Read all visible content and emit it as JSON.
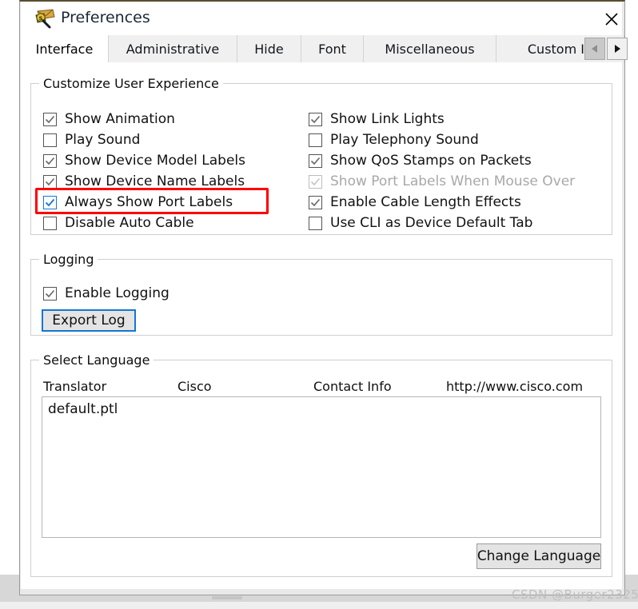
{
  "window": {
    "title": "Preferences",
    "icon": "packet-tracer-envelope-magnifier-icon",
    "close_label": "✕"
  },
  "tabs": {
    "items": [
      {
        "label": "Interface",
        "active": true
      },
      {
        "label": "Administrative",
        "active": false
      },
      {
        "label": "Hide",
        "active": false
      },
      {
        "label": "Font",
        "active": false
      },
      {
        "label": "Miscellaneous",
        "active": false
      },
      {
        "label": "Custom In",
        "active": false
      }
    ],
    "scroll_left": "◀",
    "scroll_right": "▶"
  },
  "customize": {
    "title": "Customize User Experience",
    "left_column": [
      {
        "label": "Show Animation",
        "checked": true,
        "enabled": true,
        "highlighted": false
      },
      {
        "label": "Play Sound",
        "checked": false,
        "enabled": true,
        "highlighted": false
      },
      {
        "label": "Show Device Model Labels",
        "checked": true,
        "enabled": true,
        "highlighted": false
      },
      {
        "label": "Show Device Name Labels",
        "checked": true,
        "enabled": true,
        "highlighted": false
      },
      {
        "label": "Always Show Port Labels",
        "checked": true,
        "enabled": true,
        "highlighted": true
      },
      {
        "label": "Disable Auto Cable",
        "checked": false,
        "enabled": true,
        "highlighted": false
      }
    ],
    "right_column": [
      {
        "label": "Show Link Lights",
        "checked": true,
        "enabled": true,
        "highlighted": false
      },
      {
        "label": "Play Telephony Sound",
        "checked": false,
        "enabled": true,
        "highlighted": false
      },
      {
        "label": "Show QoS Stamps on Packets",
        "checked": true,
        "enabled": true,
        "highlighted": false
      },
      {
        "label": "Show Port Labels When Mouse Over",
        "checked": true,
        "enabled": false,
        "highlighted": false
      },
      {
        "label": "Enable Cable Length Effects",
        "checked": true,
        "enabled": true,
        "highlighted": false
      },
      {
        "label": "Use CLI as Device Default Tab",
        "checked": false,
        "enabled": true,
        "highlighted": false
      }
    ],
    "highlight_color": "#ff0000"
  },
  "logging": {
    "title": "Logging",
    "enable_logging": {
      "label": "Enable Logging",
      "checked": true
    },
    "export_button": "Export Log",
    "export_button_focus_color": "#1676d2"
  },
  "language": {
    "title": "Select Language",
    "headers": [
      "Translator",
      "Cisco",
      "Contact Info",
      "http://www.cisco.com"
    ],
    "list_items": [
      "default.ptl"
    ],
    "change_button": "Change Language"
  },
  "watermark": "CSDN @Burger2325"
}
